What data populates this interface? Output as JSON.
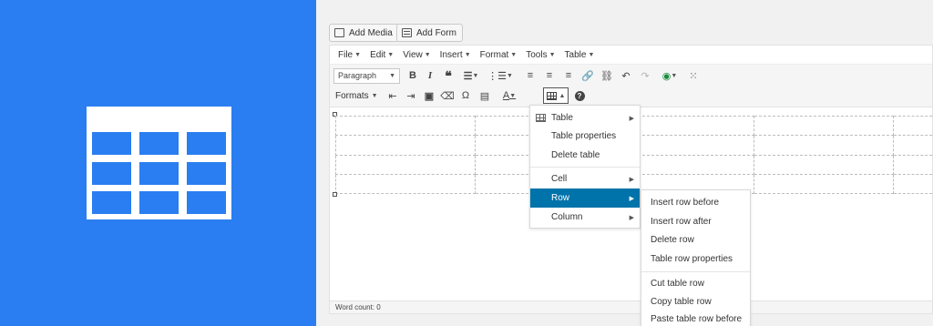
{
  "hero": {
    "logo": "table-logo"
  },
  "editor": {
    "media_buttons": [
      {
        "label": "Add Media",
        "icon": "media-icon"
      },
      {
        "label": "Add Form",
        "icon": "form-icon"
      }
    ],
    "menubar": [
      "File",
      "Edit",
      "View",
      "Insert",
      "Format",
      "Tools",
      "Table"
    ],
    "toolbar1": {
      "paragraph_select": "Paragraph",
      "buttons": [
        "bold-icon",
        "italic-icon",
        "blockquote-icon",
        "bullet-list-icon",
        "numbered-list-icon",
        "align-left-icon",
        "align-center-icon",
        "align-right-icon",
        "link-icon",
        "unlink-icon",
        "undo-icon",
        "redo-icon",
        "emoji-icon",
        "toolbar-toggle-icon"
      ]
    },
    "toolbar2": {
      "formats": "Formats",
      "buttons": [
        "indent-icon",
        "outdent-icon",
        "paste-text-icon",
        "clear-formatting-icon",
        "special-character-icon",
        "horizontal-rule-icon",
        "text-color-icon",
        "table-icon",
        "help-icon"
      ]
    },
    "status": {
      "word_count": "Word count: 0"
    }
  },
  "table_menu": {
    "items": [
      "Table",
      "Table properties",
      "Delete table",
      "Cell",
      "Row",
      "Column"
    ],
    "highlighted": "Row"
  },
  "row_submenu": {
    "items": [
      "Insert row before",
      "Insert row after",
      "Delete row",
      "Table row properties",
      "Cut table row",
      "Copy table row",
      "Paste table row before"
    ]
  },
  "colors": {
    "hero_blue": "#2a7ef1",
    "highlight": "#0073aa"
  }
}
